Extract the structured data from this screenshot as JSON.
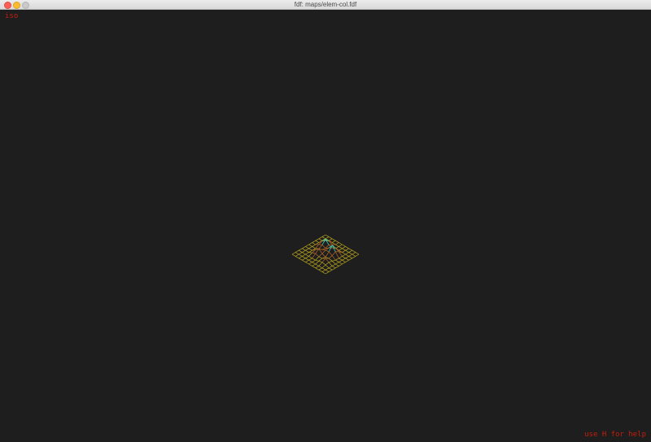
{
  "window": {
    "title": "fdf: maps/elem-col.fdf"
  },
  "overlay": {
    "projection_label": "iso",
    "help_hint": "use H for help"
  },
  "colors": {
    "background": "#1e1e1e",
    "overlay_text": "#c41e0e",
    "wire_low": "#b8a51c",
    "wire_mid": "#b56a2a",
    "wire_high": "#3fe6c8"
  },
  "icons": {
    "close": "close-traffic-light-icon",
    "minimize": "minimize-traffic-light-icon",
    "zoom": "zoom-traffic-light-icon"
  }
}
